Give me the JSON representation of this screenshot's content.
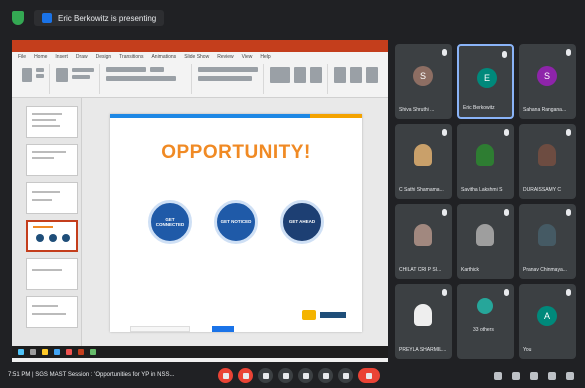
{
  "meet": {
    "presenting_label": "Eric Berkowitz is presenting",
    "time": "7:51 PM",
    "meeting_title": "SGS MAST Session : 'Opportunities for YP in NSS...",
    "participants_label": "33 others"
  },
  "ppt": {
    "ribbon_tabs": [
      "File",
      "Home",
      "Insert",
      "Draw",
      "Design",
      "Transitions",
      "Animations",
      "Slide Show",
      "Review",
      "View",
      "Help"
    ]
  },
  "slide": {
    "title": "OPPORTUNITY!",
    "circles": [
      {
        "label": "GET CONNECTED"
      },
      {
        "label": "GET NOTICED"
      },
      {
        "label": "GET AHEAD"
      }
    ]
  },
  "participants": [
    {
      "name": "Shiva Shruthi ...",
      "type": "initial",
      "initial": "S",
      "color": "#8d6e63",
      "active": false
    },
    {
      "name": "Eric Berkowitz",
      "type": "initial",
      "initial": "E",
      "color": "#00897b",
      "active": true
    },
    {
      "name": "Sahana Rangana...",
      "type": "initial",
      "initial": "S",
      "color": "#8e24aa",
      "active": false
    },
    {
      "name": "C Sathi Shamama...",
      "type": "photo",
      "color": "#c9a06a",
      "active": false
    },
    {
      "name": "Savitha Lakshmi S",
      "type": "photo",
      "color": "#2e7d32",
      "active": false
    },
    {
      "name": "DURAISSAMY C",
      "type": "photo",
      "color": "#6d4c41",
      "active": false
    },
    {
      "name": "CHILAT CRI P SI...",
      "type": "photo",
      "color": "#a1887f",
      "active": false
    },
    {
      "name": "Karthick",
      "type": "photo",
      "color": "#9e9e9e",
      "active": false
    },
    {
      "name": "Pranav Chinmaya...",
      "type": "photo",
      "color": "#455a64",
      "active": false
    },
    {
      "name": "PREYLA SHARMIL...",
      "type": "photo",
      "color": "#eeeeee",
      "active": false
    },
    {
      "name": "33 others",
      "type": "group",
      "color": "#26a69a",
      "active": false
    },
    {
      "name": "You",
      "type": "initial",
      "initial": "A",
      "color": "#00897b",
      "active": false
    }
  ]
}
